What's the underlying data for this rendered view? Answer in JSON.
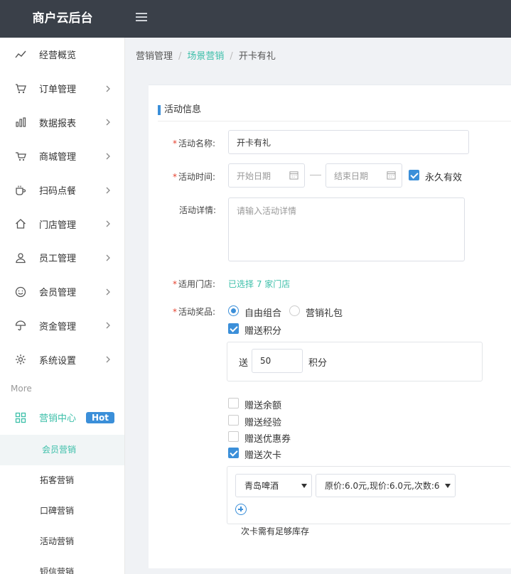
{
  "app": {
    "title": "商户云后台"
  },
  "sidebar": {
    "items": [
      {
        "label": "经营概览",
        "icon": "trend-icon",
        "chevron": false
      },
      {
        "label": "订单管理",
        "icon": "cart-icon",
        "chevron": true
      },
      {
        "label": "数据报表",
        "icon": "bar-chart-icon",
        "chevron": true
      },
      {
        "label": "商城管理",
        "icon": "shop-cart-icon",
        "chevron": true
      },
      {
        "label": "扫码点餐",
        "icon": "cup-icon",
        "chevron": true
      },
      {
        "label": "门店管理",
        "icon": "home-icon",
        "chevron": true
      },
      {
        "label": "员工管理",
        "icon": "user-icon",
        "chevron": true
      },
      {
        "label": "会员管理",
        "icon": "smile-icon",
        "chevron": true
      },
      {
        "label": "资金管理",
        "icon": "umbrella-icon",
        "chevron": true
      },
      {
        "label": "系统设置",
        "icon": "gear-icon",
        "chevron": true
      }
    ],
    "more_label": "More",
    "marketing": {
      "label": "营销中心",
      "badge": "Hot"
    },
    "sub_items": [
      "会员营销",
      "拓客营销",
      "口碑营销",
      "活动营销",
      "短信营销"
    ]
  },
  "breadcrumb": {
    "root": "营销管理",
    "middle": "场景营销",
    "current": "开卡有礼"
  },
  "form": {
    "section_title": "活动信息",
    "name": {
      "label": "活动名称:",
      "value": "开卡有礼"
    },
    "time": {
      "label": "活动时间:",
      "start_placeholder": "开始日期",
      "end_placeholder": "结束日期",
      "forever_label": "永久有效",
      "forever_checked": true
    },
    "detail": {
      "label": "活动详情:",
      "placeholder": "请输入活动详情"
    },
    "store": {
      "label": "适用门店:",
      "value": "已选择 7 家门店"
    },
    "prize": {
      "label": "活动奖品:",
      "radio_options": [
        "自由组合",
        "营销礼包"
      ],
      "selected": "自由组合",
      "points": {
        "label": "赠送积分",
        "checked": true,
        "prefix": "送",
        "value": "50",
        "suffix": "积分"
      },
      "other_options": [
        {
          "label": "赠送余额",
          "checked": false
        },
        {
          "label": "赠送经验",
          "checked": false
        },
        {
          "label": "赠送优惠券",
          "checked": false
        },
        {
          "label": "赠送次卡",
          "checked": true
        }
      ],
      "card": {
        "product": "青岛啤酒",
        "price": "原价:6.0元,现价:6.0元,次数:6",
        "note": "次卡需有足够库存"
      }
    }
  },
  "colors": {
    "accent": "#3b8fd9",
    "teal": "#3cbfa9",
    "topbar": "#3a4049",
    "required": "#e5412e"
  }
}
